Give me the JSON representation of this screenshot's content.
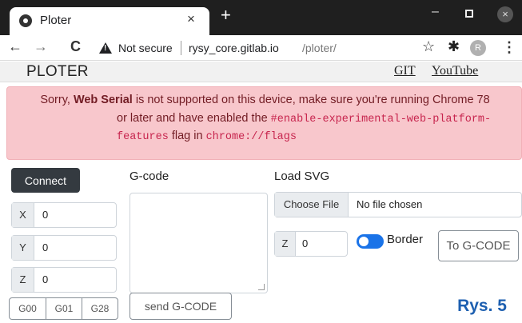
{
  "browser": {
    "tab_title": "Ploter",
    "tab_close": "×",
    "new_tab": "+",
    "security_label": "Not secure",
    "url_host": "rysy_core.gitlab.io",
    "url_path": "/ploter/",
    "profile_initial": "R",
    "icons": {
      "back": "←",
      "forward": "→",
      "reload": "C",
      "star": "☆",
      "extensions": "✱",
      "menu": "⋮",
      "minimize": "–",
      "close": "×"
    }
  },
  "header": {
    "brand": "PLOTER",
    "links": [
      "GIT",
      "YouTube"
    ]
  },
  "error": {
    "line1_pre": "Sorry, ",
    "line1_bold": "Web Serial",
    "line1_post": " is not supported on this device, make sure you're running Chrome 78",
    "line2_pre": "or later and have enabled the ",
    "line2_code": "#enable-experimental-web-platform-",
    "line3_code1": "features",
    "line3_mid": " flag in ",
    "line3_code2": "chrome://flags",
    "color_bg": "#f8c7cc",
    "color_text": "#721c24"
  },
  "controls": {
    "connect_label": "Connect",
    "axes": [
      {
        "label": "X",
        "value": "0"
      },
      {
        "label": "Y",
        "value": "0"
      },
      {
        "label": "Z",
        "value": "0"
      }
    ],
    "gbuttons": [
      "G00",
      "G01",
      "G28"
    ]
  },
  "gcode": {
    "label": "G-code",
    "value": "",
    "send_label": "send G-CODE"
  },
  "svg": {
    "label": "Load SVG",
    "choose_label": "Choose File",
    "file_status": "No file chosen",
    "z_label": "Z",
    "z_value": "0",
    "border_label": "Border",
    "border_on": true,
    "convert_label": "To G-CODE"
  },
  "caption": "Rys. 5"
}
